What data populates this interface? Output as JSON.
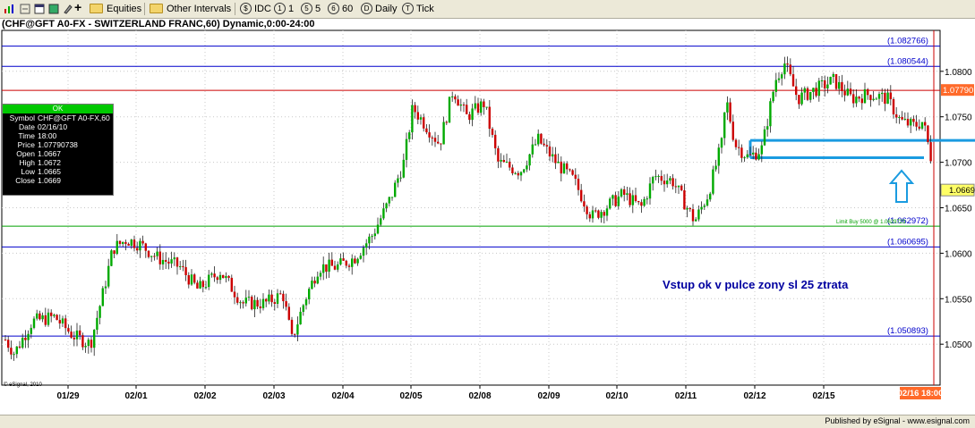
{
  "toolbar": {
    "equities_label": "Equities",
    "other_intervals_label": "Other Intervals",
    "idc_label": "IDC",
    "interval_1": "1",
    "interval_5": "5",
    "interval_60": "60",
    "daily_label": "Daily",
    "tick_label": "Tick"
  },
  "chart_title": "(CHF@GFT A0-FX - SWITZERLAND FRANC,60) Dynamic,0:00-24:00",
  "info": {
    "header": "OK",
    "rows": [
      {
        "k": "Symbol",
        "v": "CHF@GFT A0-FX,60"
      },
      {
        "k": "Date",
        "v": "02/16/10"
      },
      {
        "k": "Time",
        "v": "18:00"
      },
      {
        "k": "Price",
        "v": "1.07790738"
      },
      {
        "k": "Open",
        "v": "1.0667"
      },
      {
        "k": "High",
        "v": "1.0672"
      },
      {
        "k": "Low",
        "v": "1.0665"
      },
      {
        "k": "Close",
        "v": "1.0669"
      }
    ]
  },
  "annotation": "Vstup ok v pulce zony sl 25 ztrata",
  "limit_label": "Limit Buy 5000 @ 1.0629723",
  "esignal_credit": "© eSignal, 2010",
  "footer": "Published by eSignal - www.esignal.com",
  "colors": {
    "up": "#00aa00",
    "down": "#cc0000",
    "level": "#0000cc",
    "zone": "#1a9be0"
  },
  "chart_data": {
    "type": "candlestick",
    "title": "(CHF@GFT A0-FX - SWITZERLAND FRANC,60) Dynamic,0:00-24:00",
    "ylim": [
      1.0455,
      1.0845
    ],
    "y_ticks": [
      "1.0500",
      "1.0550",
      "1.0600",
      "1.0650",
      "1.0700",
      "1.0750",
      "1.0800"
    ],
    "x_ticks": [
      "01/29",
      "02/01",
      "02/02",
      "02/03",
      "02/04",
      "02/05",
      "02/08",
      "02/09",
      "02/10",
      "02/11",
      "02/12",
      "02/15"
    ],
    "current_time_label": "02/16 18:00",
    "current_price": {
      "value": 1.0779,
      "label": "1.07790"
    },
    "last_close": {
      "value": 1.0669,
      "label": "1.0669"
    },
    "levels": [
      {
        "value": 1.082766,
        "label": "(1.082766)"
      },
      {
        "value": 1.080544,
        "label": "(1.080544)"
      },
      {
        "value": 1.062972,
        "label": "(1.062972)"
      },
      {
        "value": 1.060695,
        "label": "(1.060695)"
      },
      {
        "value": 1.050893,
        "label": "(1.050893)"
      }
    ],
    "zone": {
      "top": 1.0724,
      "bottom": 1.0705
    },
    "path": [
      {
        "t": 0,
        "p": 1.0505
      },
      {
        "t": 10,
        "p": 1.049
      },
      {
        "t": 30,
        "p": 1.0525
      },
      {
        "t": 55,
        "p": 1.053
      },
      {
        "t": 75,
        "p": 1.051
      },
      {
        "t": 95,
        "p": 1.05
      },
      {
        "t": 110,
        "p": 1.056
      },
      {
        "t": 120,
        "p": 1.0605
      },
      {
        "t": 135,
        "p": 1.0615
      },
      {
        "t": 150,
        "p": 1.061
      },
      {
        "t": 170,
        "p": 1.0595
      },
      {
        "t": 195,
        "p": 1.0585
      },
      {
        "t": 215,
        "p": 1.056
      },
      {
        "t": 240,
        "p": 1.058
      },
      {
        "t": 265,
        "p": 1.0545
      },
      {
        "t": 290,
        "p": 1.0545
      },
      {
        "t": 310,
        "p": 1.0555
      },
      {
        "t": 320,
        "p": 1.0505
      },
      {
        "t": 335,
        "p": 1.055
      },
      {
        "t": 350,
        "p": 1.0585
      },
      {
        "t": 370,
        "p": 1.0585
      },
      {
        "t": 390,
        "p": 1.0595
      },
      {
        "t": 410,
        "p": 1.062
      },
      {
        "t": 430,
        "p": 1.066
      },
      {
        "t": 445,
        "p": 1.07
      },
      {
        "t": 455,
        "p": 1.076
      },
      {
        "t": 470,
        "p": 1.074
      },
      {
        "t": 485,
        "p": 1.072
      },
      {
        "t": 500,
        "p": 1.078
      },
      {
        "t": 515,
        "p": 1.075
      },
      {
        "t": 535,
        "p": 1.0765
      },
      {
        "t": 550,
        "p": 1.07
      },
      {
        "t": 575,
        "p": 1.069
      },
      {
        "t": 595,
        "p": 1.0725
      },
      {
        "t": 615,
        "p": 1.07
      },
      {
        "t": 635,
        "p": 1.068
      },
      {
        "t": 655,
        "p": 1.064
      },
      {
        "t": 670,
        "p": 1.065
      },
      {
        "t": 690,
        "p": 1.0665
      },
      {
        "t": 710,
        "p": 1.065
      },
      {
        "t": 725,
        "p": 1.0685
      },
      {
        "t": 745,
        "p": 1.068
      },
      {
        "t": 770,
        "p": 1.0635
      },
      {
        "t": 785,
        "p": 1.0665
      },
      {
        "t": 800,
        "p": 1.072
      },
      {
        "t": 805,
        "p": 1.077
      },
      {
        "t": 815,
        "p": 1.072
      },
      {
        "t": 830,
        "p": 1.0705
      },
      {
        "t": 845,
        "p": 1.0715
      },
      {
        "t": 860,
        "p": 1.079
      },
      {
        "t": 870,
        "p": 1.081
      },
      {
        "t": 885,
        "p": 1.077
      },
      {
        "t": 905,
        "p": 1.078
      },
      {
        "t": 925,
        "p": 1.079
      },
      {
        "t": 945,
        "p": 1.077
      },
      {
        "t": 965,
        "p": 1.0775
      },
      {
        "t": 985,
        "p": 1.077
      },
      {
        "t": 1000,
        "p": 1.0745
      },
      {
        "t": 1015,
        "p": 1.074
      },
      {
        "t": 1025,
        "p": 1.0745
      },
      {
        "t": 1035,
        "p": 1.07
      },
      {
        "t": 1043,
        "p": 1.0669
      }
    ]
  }
}
